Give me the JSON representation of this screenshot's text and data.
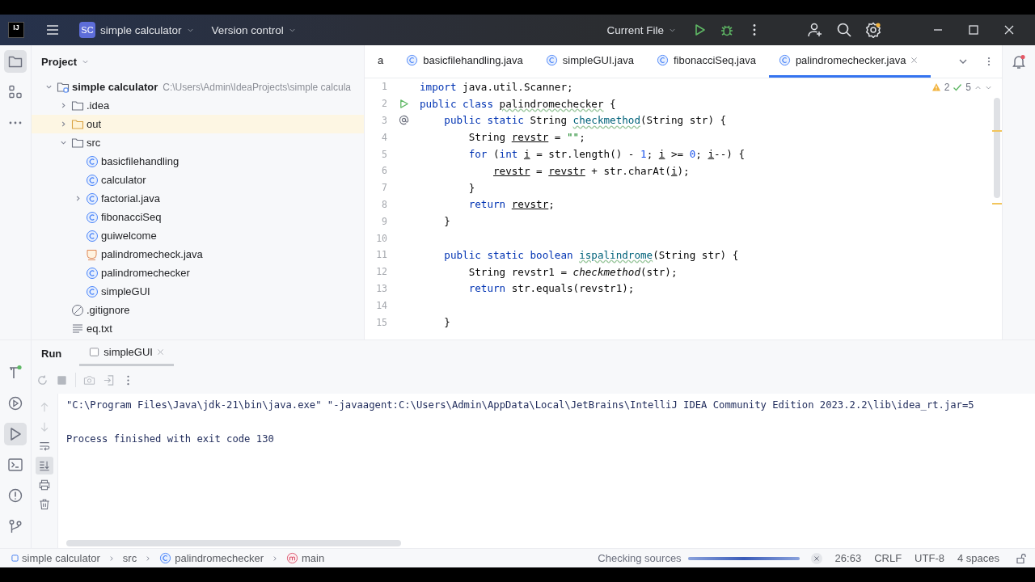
{
  "title_bar": {
    "logo": "IJ",
    "project_badge": "SC",
    "project": "simple calculator",
    "vcs": "Version control",
    "run_config": "Current File"
  },
  "project_panel": {
    "title": "Project",
    "tree": [
      {
        "name": "simple calculator",
        "path": "C:\\Users\\Admin\\IdeaProjects\\simple calcula",
        "kind": "module",
        "expanded": true,
        "highlighted": false,
        "children": [
          {
            "name": ".idea",
            "kind": "folder",
            "expanded": false,
            "highlighted": false
          },
          {
            "name": "out",
            "kind": "folder",
            "expanded": false,
            "highlighted": true
          },
          {
            "name": "src",
            "kind": "folder",
            "expanded": true,
            "highlighted": false,
            "children": [
              {
                "name": "basicfilehandling",
                "kind": "class",
                "highlighted": false
              },
              {
                "name": "calculator",
                "kind": "class",
                "highlighted": false
              },
              {
                "name": "factorial.java",
                "kind": "class",
                "expanded": false,
                "highlighted": false
              },
              {
                "name": "fibonacciSeq",
                "kind": "class",
                "highlighted": false
              },
              {
                "name": "guiwelcome",
                "kind": "class",
                "highlighted": false
              },
              {
                "name": "palindromecheck.java",
                "kind": "java",
                "highlighted": false
              },
              {
                "name": "palindromechecker",
                "kind": "class",
                "highlighted": false
              },
              {
                "name": "simpleGUI",
                "kind": "class",
                "highlighted": false
              }
            ]
          },
          {
            "name": ".gitignore",
            "kind": "ignore",
            "highlighted": false
          },
          {
            "name": "eq.txt",
            "kind": "text",
            "highlighted": false
          }
        ]
      }
    ]
  },
  "editor": {
    "tabs": [
      {
        "label": "a",
        "icon": false,
        "selected": false
      },
      {
        "label": "basicfilehandling.java",
        "icon": true,
        "selected": false
      },
      {
        "label": "simpleGUI.java",
        "icon": true,
        "selected": false
      },
      {
        "label": "fibonacciSeq.java",
        "icon": true,
        "selected": false
      },
      {
        "label": "palindromechecker.java",
        "icon": true,
        "selected": true
      }
    ],
    "inspections": {
      "warnings": "2",
      "passed": "5"
    },
    "lines": [
      {
        "number": "1",
        "kind": "code",
        "tokens": [
          {
            "text": "import",
            "kind": "keyword"
          },
          {
            "text": " java.util.Scanner;",
            "kind": "plain"
          }
        ]
      },
      {
        "number": "2",
        "kind": "run",
        "tokens": [
          {
            "text": "public class",
            "kind": "keyword"
          },
          {
            "text": " palindromechecker",
            "kind": "typo"
          },
          {
            "text": " {",
            "kind": "plain"
          }
        ]
      },
      {
        "number": "3",
        "kind": "override",
        "tokens": [
          {
            "text": "    public static",
            "kind": "keyword"
          },
          {
            "text": " String ",
            "kind": "plain"
          },
          {
            "text": "checkmethod",
            "kind": "method"
          },
          {
            "text": "(String str) {",
            "kind": "plain"
          }
        ]
      },
      {
        "number": "4",
        "kind": "code",
        "tokens": [
          {
            "text": "        String ",
            "kind": "plain"
          },
          {
            "text": "revstr",
            "kind": "variable"
          },
          {
            "text": " = ",
            "kind": "plain"
          },
          {
            "text": "\"\"",
            "kind": "string"
          },
          {
            "text": ";",
            "kind": "plain"
          }
        ]
      },
      {
        "number": "5",
        "kind": "code",
        "tokens": [
          {
            "text": "        for",
            "kind": "keyword"
          },
          {
            "text": " (",
            "kind": "plain"
          },
          {
            "text": "int",
            "kind": "keyword"
          },
          {
            "text": " i",
            "kind": "variable"
          },
          {
            "text": " = str.length() - ",
            "kind": "plain"
          },
          {
            "text": "1",
            "kind": "number"
          },
          {
            "text": "; ",
            "kind": "plain"
          },
          {
            "text": "i",
            "kind": "variable"
          },
          {
            "text": " >= ",
            "kind": "plain"
          },
          {
            "text": "0",
            "kind": "number"
          },
          {
            "text": "; ",
            "kind": "plain"
          },
          {
            "text": "i",
            "kind": "variable"
          },
          {
            "text": "--) {",
            "kind": "plain"
          }
        ]
      },
      {
        "number": "6",
        "kind": "code",
        "tokens": [
          {
            "text": "            revstr",
            "kind": "variable"
          },
          {
            "text": " = ",
            "kind": "plain"
          },
          {
            "text": "revstr",
            "kind": "variable"
          },
          {
            "text": " + str.charAt(",
            "kind": "plain"
          },
          {
            "text": "i",
            "kind": "variable"
          },
          {
            "text": ");",
            "kind": "plain"
          }
        ]
      },
      {
        "number": "7",
        "kind": "code",
        "tokens": [
          {
            "text": "        }",
            "kind": "plain"
          }
        ]
      },
      {
        "number": "8",
        "kind": "code",
        "tokens": [
          {
            "text": "        return",
            "kind": "keyword"
          },
          {
            "text": " revstr",
            "kind": "variable"
          },
          {
            "text": ";",
            "kind": "plain"
          }
        ]
      },
      {
        "number": "9",
        "kind": "code",
        "tokens": [
          {
            "text": "    }",
            "kind": "plain"
          }
        ]
      },
      {
        "number": "10",
        "kind": "code"
      },
      {
        "number": "11",
        "kind": "code",
        "tokens": [
          {
            "text": "    public static boolean",
            "kind": "keyword"
          },
          {
            "text": " ispalindrome",
            "kind": "method"
          },
          {
            "text": "(String str) {",
            "kind": "plain"
          }
        ]
      },
      {
        "number": "12",
        "kind": "code",
        "tokens": [
          {
            "text": "        String revstr1 = ",
            "kind": "plain"
          },
          {
            "text": "checkmethod",
            "kind": "call"
          },
          {
            "text": "(str);",
            "kind": "plain"
          }
        ]
      },
      {
        "number": "13",
        "kind": "code",
        "tokens": [
          {
            "text": "        return",
            "kind": "keyword"
          },
          {
            "text": " str.equals(revstr1);",
            "kind": "plain"
          }
        ]
      },
      {
        "number": "14",
        "kind": "code"
      },
      {
        "number": "15",
        "kind": "code",
        "tokens": [
          {
            "text": "    }",
            "kind": "plain"
          }
        ]
      }
    ]
  },
  "run_panel": {
    "title": "Run",
    "tabs": [
      {
        "label": "simpleGUI",
        "selected": true
      }
    ],
    "console": [
      "\"C:\\Program Files\\Java\\jdk-21\\bin\\java.exe\" \"-javaagent:C:\\Users\\Admin\\AppData\\Local\\JetBrains\\IntelliJ IDEA Community Edition 2023.2.2\\lib\\idea_rt.jar=5",
      "Process finished with exit code 130"
    ]
  },
  "status_bar": {
    "breadcrumbs": [
      {
        "label": "simple calculator",
        "kind": "module"
      },
      {
        "label": "src",
        "kind": "folder"
      },
      {
        "label": "palindromechecker",
        "kind": "class"
      },
      {
        "label": "main",
        "kind": "method"
      }
    ],
    "task": "Checking sources",
    "progress": {
      "level": 1
    },
    "position": "26:63",
    "line_separator": "CRLF",
    "encoding": "UTF-8",
    "indent": "4 spaces"
  }
}
